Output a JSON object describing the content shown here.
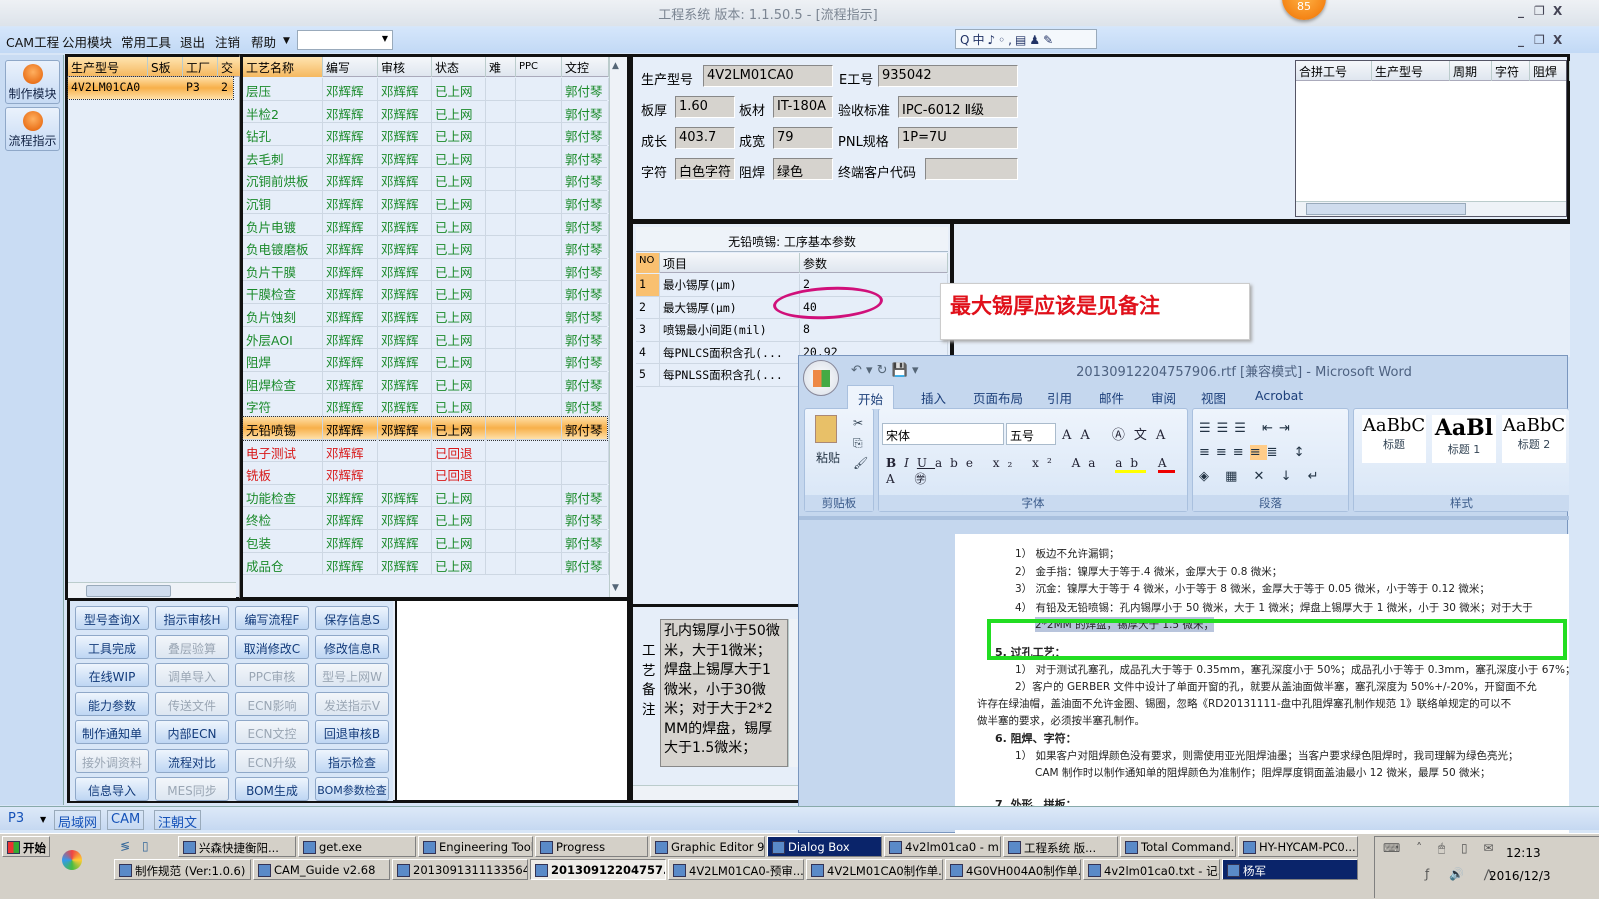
{
  "window": {
    "title": "工程系统  版本: 1.1.50.5 - [流程指示]",
    "badge": "85",
    "controls": [
      "_",
      "❐",
      "X"
    ]
  },
  "menu": [
    "CAM工程",
    "公用模块",
    "常用工具",
    "退出",
    "注销",
    "帮助"
  ],
  "ime_bar": "Q中♪◦,▤♟✎",
  "nav": [
    {
      "label": "制作模块"
    },
    {
      "label": "流程指示"
    }
  ],
  "model_grid": {
    "headers": [
      "生产型号",
      "S板",
      "工厂",
      "交"
    ],
    "rows": [
      [
        "4V2LM01CA0",
        "",
        "P3",
        "2"
      ]
    ]
  },
  "process_grid": {
    "headers": [
      "工艺名称",
      "编写",
      "审核",
      "状态",
      "难",
      "PPC",
      "文控"
    ],
    "rows": [
      [
        "层压",
        "邓辉辉",
        "邓辉辉",
        "已上网",
        "",
        "",
        "郭付琴",
        "green"
      ],
      [
        "半检2",
        "邓辉辉",
        "邓辉辉",
        "已上网",
        "",
        "",
        "郭付琴",
        "green"
      ],
      [
        "钻孔",
        "邓辉辉",
        "邓辉辉",
        "已上网",
        "",
        "",
        "郭付琴",
        "green"
      ],
      [
        "去毛刺",
        "邓辉辉",
        "邓辉辉",
        "已上网",
        "",
        "",
        "郭付琴",
        "green"
      ],
      [
        "沉铜前烘板",
        "邓辉辉",
        "邓辉辉",
        "已上网",
        "",
        "",
        "郭付琴",
        "green"
      ],
      [
        "沉铜",
        "邓辉辉",
        "邓辉辉",
        "已上网",
        "",
        "",
        "郭付琴",
        "green"
      ],
      [
        "负片电镀",
        "邓辉辉",
        "邓辉辉",
        "已上网",
        "",
        "",
        "郭付琴",
        "green"
      ],
      [
        "负电镀磨板",
        "邓辉辉",
        "邓辉辉",
        "已上网",
        "",
        "",
        "郭付琴",
        "green"
      ],
      [
        "负片干膜",
        "邓辉辉",
        "邓辉辉",
        "已上网",
        "",
        "",
        "郭付琴",
        "green"
      ],
      [
        "干膜检查",
        "邓辉辉",
        "邓辉辉",
        "已上网",
        "",
        "",
        "郭付琴",
        "green"
      ],
      [
        "负片蚀刻",
        "邓辉辉",
        "邓辉辉",
        "已上网",
        "",
        "",
        "郭付琴",
        "green"
      ],
      [
        "外层AOI",
        "邓辉辉",
        "邓辉辉",
        "已上网",
        "",
        "",
        "郭付琴",
        "green"
      ],
      [
        "阻焊",
        "邓辉辉",
        "邓辉辉",
        "已上网",
        "",
        "",
        "郭付琴",
        "green"
      ],
      [
        "阻焊检查",
        "邓辉辉",
        "邓辉辉",
        "已上网",
        "",
        "",
        "郭付琴",
        "green"
      ],
      [
        "字符",
        "邓辉辉",
        "邓辉辉",
        "已上网",
        "",
        "",
        "郭付琴",
        "green"
      ],
      [
        "无铅喷锡",
        "邓辉辉",
        "邓辉辉",
        "已上网",
        "",
        "",
        "郭付琴",
        "selected"
      ],
      [
        "电子测试",
        "邓辉辉",
        "",
        "已回退",
        "",
        "",
        "",
        "red"
      ],
      [
        "铣板",
        "邓辉辉",
        "",
        "已回退",
        "",
        "",
        "",
        "red"
      ],
      [
        "功能检查",
        "邓辉辉",
        "邓辉辉",
        "已上网",
        "",
        "",
        "郭付琴",
        "green"
      ],
      [
        "终检",
        "邓辉辉",
        "邓辉辉",
        "已上网",
        "",
        "",
        "郭付琴",
        "green"
      ],
      [
        "包装",
        "邓辉辉",
        "邓辉辉",
        "已上网",
        "",
        "",
        "郭付琴",
        "green"
      ],
      [
        "成品仓",
        "邓辉辉",
        "邓辉辉",
        "已上网",
        "",
        "",
        "郭付琴",
        "green"
      ]
    ]
  },
  "buttons": [
    [
      "型号查询X",
      "指示审核H",
      "编写流程F",
      "保存信息S"
    ],
    [
      "工具完成",
      "叠层验算",
      "取消修改C",
      "修改信息R"
    ],
    [
      "在线WIP",
      "调单导入",
      "PPC审核",
      "型号上网W"
    ],
    [
      "能力参数",
      "传送文件",
      "ECN影响",
      "发送指示V"
    ],
    [
      "制作通知单",
      "内部ECN",
      "ECN文控",
      "回退审核B"
    ],
    [
      "接外调资料",
      "流程对比",
      "ECN升级",
      "指示检查"
    ],
    [
      "信息导入",
      "MES同步",
      "BOM生成",
      "BOM参数检查"
    ]
  ],
  "buttons_disabled": [
    [
      1,
      1
    ],
    [
      2,
      1
    ],
    [
      2,
      2
    ],
    [
      2,
      3
    ],
    [
      3,
      1
    ],
    [
      3,
      2
    ],
    [
      3,
      3
    ],
    [
      4,
      2
    ],
    [
      5,
      0
    ],
    [
      5,
      2
    ],
    [
      6,
      1
    ]
  ],
  "info": {
    "fields": [
      {
        "label": "生产型号",
        "value": "4V2LM01CA0"
      },
      {
        "label": "E工号",
        "value": "935042"
      },
      {
        "label": "板厚",
        "value": "1.60"
      },
      {
        "label": "板材",
        "value": "IT-180A"
      },
      {
        "label": "验收标准",
        "value": "IPC-6012 Ⅱ级"
      },
      {
        "label": "成长",
        "value": "403.7"
      },
      {
        "label": "成宽",
        "value": "79"
      },
      {
        "label": "PNL规格",
        "value": "1P=7U"
      },
      {
        "label": "字符",
        "value": "白色字符"
      },
      {
        "label": "阻焊",
        "value": "绿色"
      },
      {
        "label": "终端客户代码",
        "value": ""
      }
    ],
    "merge_headers": [
      "合拼工号",
      "生产型号",
      "周期",
      "字符",
      "阻焊"
    ]
  },
  "params": {
    "title": "无铅喷锡: 工序基本参数",
    "headers": [
      "NO",
      "项目",
      "参数"
    ],
    "rows": [
      [
        "1",
        "最小锡厚(μm)",
        "2"
      ],
      [
        "2",
        "最大锡厚(μm)",
        "40"
      ],
      [
        "3",
        "喷锡最小间距(mil)",
        "8"
      ],
      [
        "4",
        "每PNLCS面积含孔(...",
        "20.92"
      ],
      [
        "5",
        "每PNLSS面积含孔(...",
        ""
      ]
    ]
  },
  "remark": {
    "label": "工艺备注",
    "text": "孔内锡厚小于50微米，大于1微米；焊盘上锡厚大于1微米，小于30微米；对于大于2*2MM的焊盘，锡厚大于1.5微米；"
  },
  "annotation": {
    "text": "最大锡厚应该是见备注",
    "color": "#e0101a",
    "ellipse_color": "#d0107a",
    "highlight_color": "#22dd22"
  },
  "word": {
    "title": "20130912204757906.rtf [兼容模式] - Microsoft Word",
    "tabs": [
      "开始",
      "插入",
      "页面布局",
      "引用",
      "邮件",
      "审阅",
      "视图",
      "Acrobat"
    ],
    "font": "宋体",
    "size": "五号",
    "paste": "粘贴",
    "groups": [
      "剪贴板",
      "字体",
      "段落",
      "样式"
    ],
    "styles": [
      {
        "preview": "AaBbC",
        "name": "标题"
      },
      {
        "preview": "AaBl",
        "name": "标题 1"
      },
      {
        "preview": "AaBbC",
        "name": "标题 2"
      }
    ],
    "doc_lines": [
      "1） 板边不允许漏铜；",
      "2） 金手指：镍厚大于等于.4 微米，金厚大于 0.8 微米；",
      "3） 沉金：镍厚大于等于 4 微米，小于等于 8 微米，金厚大于等于 0.05 微米，小于等于 0.12 微米；",
      "4） 有铅及无铅喷锡：孔内锡厚小于 50 微米，大于 1 微米；焊盘上锡厚大于 1 微米，小于 30 微米；对于大于",
      "2*2MM 的焊盘，锡厚大于 1.5 微米；",
      "5.  过孔工艺：",
      "1） 对于测试孔塞孔，成品孔大于等于 0.35mm，塞孔深度小于 50%；成品孔小于等于 0.3mm，塞孔深度小于 67%；",
      "2）客户的 GERBER 文件中设计了单面开窗的孔，就要从盖油面做半塞，塞孔深度为 50%+/-20%，开窗面不允",
      "许存在绿油帽，盖油面不允许金圈、锡圈，忽略《RD20131111-盘中孔阻焊塞孔制作规范 1》联络单规定的可以不",
      "做半塞的要求，必须按半塞孔制作。",
      "6.  阻焊、字符：",
      "1） 如果客户对阻焊颜色没有要求，则需使用亚光阻焊油墨；当客户要求绿色阻焊时，我司理解为绿色亮光；",
      "CAM 制作时以制作通知单的阻焊颜色为准制作；阻焊厚度铜面盖油最小 12 微米，最厚 50 微米；",
      "7.  外形、拼板："
    ]
  },
  "status": {
    "site": "P3",
    "tabs": [
      "局域网",
      "CAM",
      "汪朝文"
    ]
  },
  "taskbar": {
    "start": "开始",
    "row1": [
      "兴森快捷衡阳...",
      "get.exe",
      "Engineering Tool...",
      "Progress",
      "Graphic Editor 9....",
      "Dialog Box",
      "4v2lm01ca0 - m...",
      "工程系统  版...",
      "Total Command...",
      "HY-HYCAM-PC0..."
    ],
    "row2": [
      "制作规范 (Ver:1.0.6)",
      "CAM_Guide v2.68",
      "2013091311133564...",
      "20130912204757...",
      "4V2LM01CA0-预审...",
      "4V2LM01CA0制作单...",
      "4G0VH004A0制作单...",
      "4v2lm01ca0.txt - 记...",
      "杨军"
    ],
    "time": "12:13",
    "date": "2016/12/3"
  }
}
